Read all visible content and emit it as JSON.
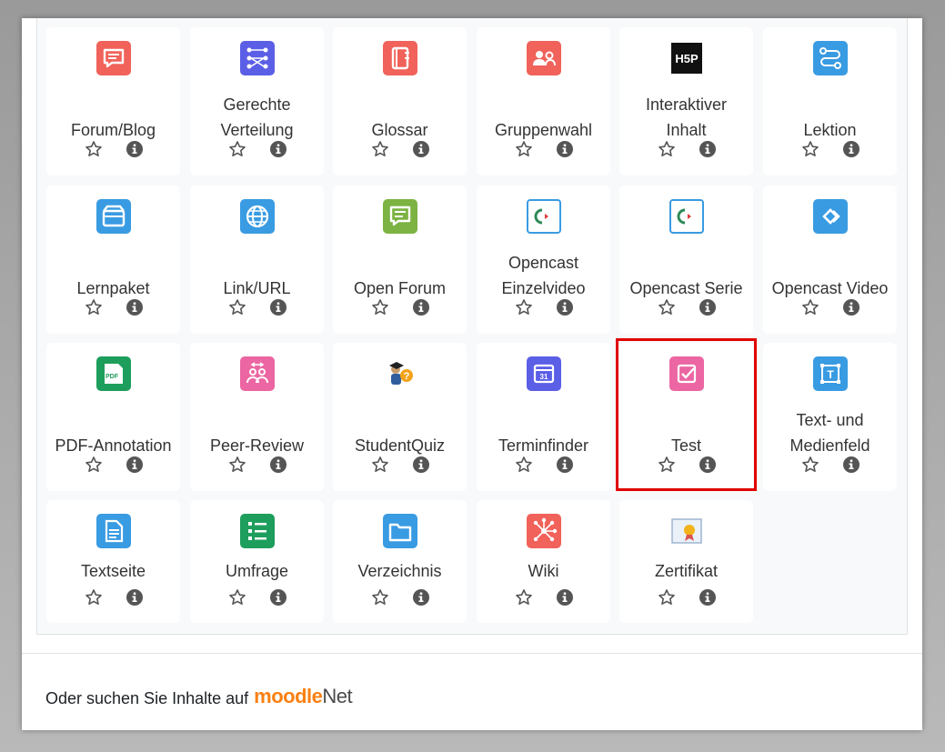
{
  "tiles": [
    {
      "label": "Forum/Blog",
      "icon": "forum-icon",
      "color": "#f0625a"
    },
    {
      "label": "Gerechte\nVerteilung",
      "icon": "distribution-icon",
      "color": "#5b5fe6"
    },
    {
      "label": "Glossar",
      "icon": "glossary-icon",
      "color": "#f0625a"
    },
    {
      "label": "Gruppenwahl",
      "icon": "group-choice-icon",
      "color": "#f0625a"
    },
    {
      "label": "Interaktiver\nInhalt",
      "icon": "h5p-icon",
      "color": "#111111"
    },
    {
      "label": "Lektion",
      "icon": "lesson-icon",
      "color": "#399be2"
    },
    {
      "label": "Lernpaket",
      "icon": "scorm-package-icon",
      "color": "#399be2"
    },
    {
      "label": "Link/URL",
      "icon": "globe-icon",
      "color": "#399be2"
    },
    {
      "label": "Open Forum",
      "icon": "open-forum-icon",
      "color": "#7cb342"
    },
    {
      "label": "Opencast\nEinzelvideo",
      "icon": "opencast-icon",
      "color": "#399be2"
    },
    {
      "label": "Opencast Serie",
      "icon": "opencast-icon",
      "color": "#399be2"
    },
    {
      "label": "Opencast Video",
      "icon": "opencast-video-icon",
      "color": "#399be2"
    },
    {
      "label": "PDF-Annotation",
      "icon": "pdf-annotation-icon",
      "color": "#1e9e5c"
    },
    {
      "label": "Peer-Review",
      "icon": "peer-review-icon",
      "color": "#eb66a2"
    },
    {
      "label": "StudentQuiz",
      "icon": "studentquiz-icon",
      "color": "#ffffff"
    },
    {
      "label": "Terminfinder",
      "icon": "calendar-icon",
      "color": "#5b5fe6"
    },
    {
      "label": "Test",
      "icon": "quiz-checkbox-icon",
      "color": "#eb66a2"
    },
    {
      "label": "Text- und\nMedienfeld",
      "icon": "text-media-icon",
      "color": "#399be2"
    },
    {
      "label": "Textseite",
      "icon": "page-icon",
      "color": "#399be2"
    },
    {
      "label": "Umfrage",
      "icon": "survey-icon",
      "color": "#1e9e5c"
    },
    {
      "label": "Verzeichnis",
      "icon": "folder-icon",
      "color": "#399be2"
    },
    {
      "label": "Wiki",
      "icon": "wiki-icon",
      "color": "#f0625a"
    },
    {
      "label": "Zertifikat",
      "icon": "certificate-icon",
      "color": "#ffffff"
    }
  ],
  "footer": {
    "text": "Oder suchen Sie Inhalte auf",
    "logo_moodle": "moodle",
    "logo_net": "Net"
  },
  "highlight_color": "#e00000"
}
